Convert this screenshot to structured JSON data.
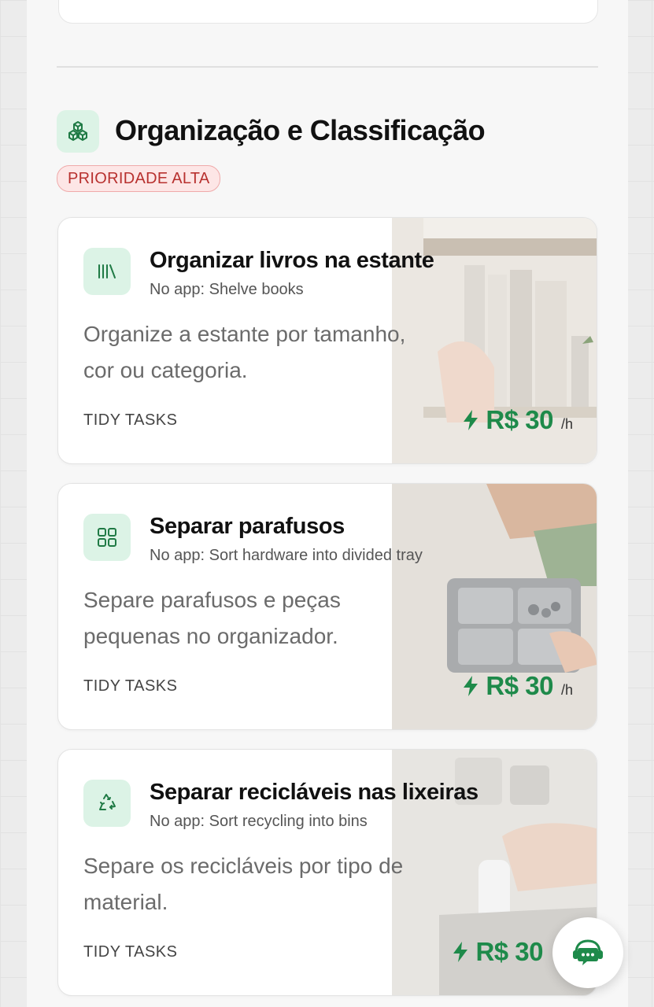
{
  "section": {
    "icon": "cubes-icon",
    "title": "Organização e Classificação",
    "badge": "PRIORIDADE ALTA"
  },
  "tasks": [
    {
      "icon": "books-icon",
      "title": "Organizar livros na estante",
      "subtitle": "No app: Shelve books",
      "description": "Organize a estante por tamanho, cor ou categoria.",
      "provider": "TIDY TASKS",
      "price": "R$ 30",
      "unit": "/h"
    },
    {
      "icon": "grid-icon",
      "title": "Separar parafusos",
      "subtitle": "No app: Sort hardware into divided tray",
      "description": "Separe parafusos e peças pequenas no organizador.",
      "provider": "TIDY TASKS",
      "price": "R$ 30",
      "unit": "/h"
    },
    {
      "icon": "recycle-icon",
      "title": "Separar recicláveis nas lixeiras",
      "subtitle": "No app: Sort recycling into bins",
      "description": "Separe os recicláveis por tipo de material.",
      "provider": "TIDY TASKS",
      "price": "R$ 30",
      "unit": ""
    }
  ],
  "fab": {
    "icon": "chat-support-icon"
  },
  "colors": {
    "accent": "#1e8a4a",
    "icon_bg": "#dcf3e6",
    "badge_text": "#b8312f",
    "badge_bg": "#fde6e6"
  }
}
